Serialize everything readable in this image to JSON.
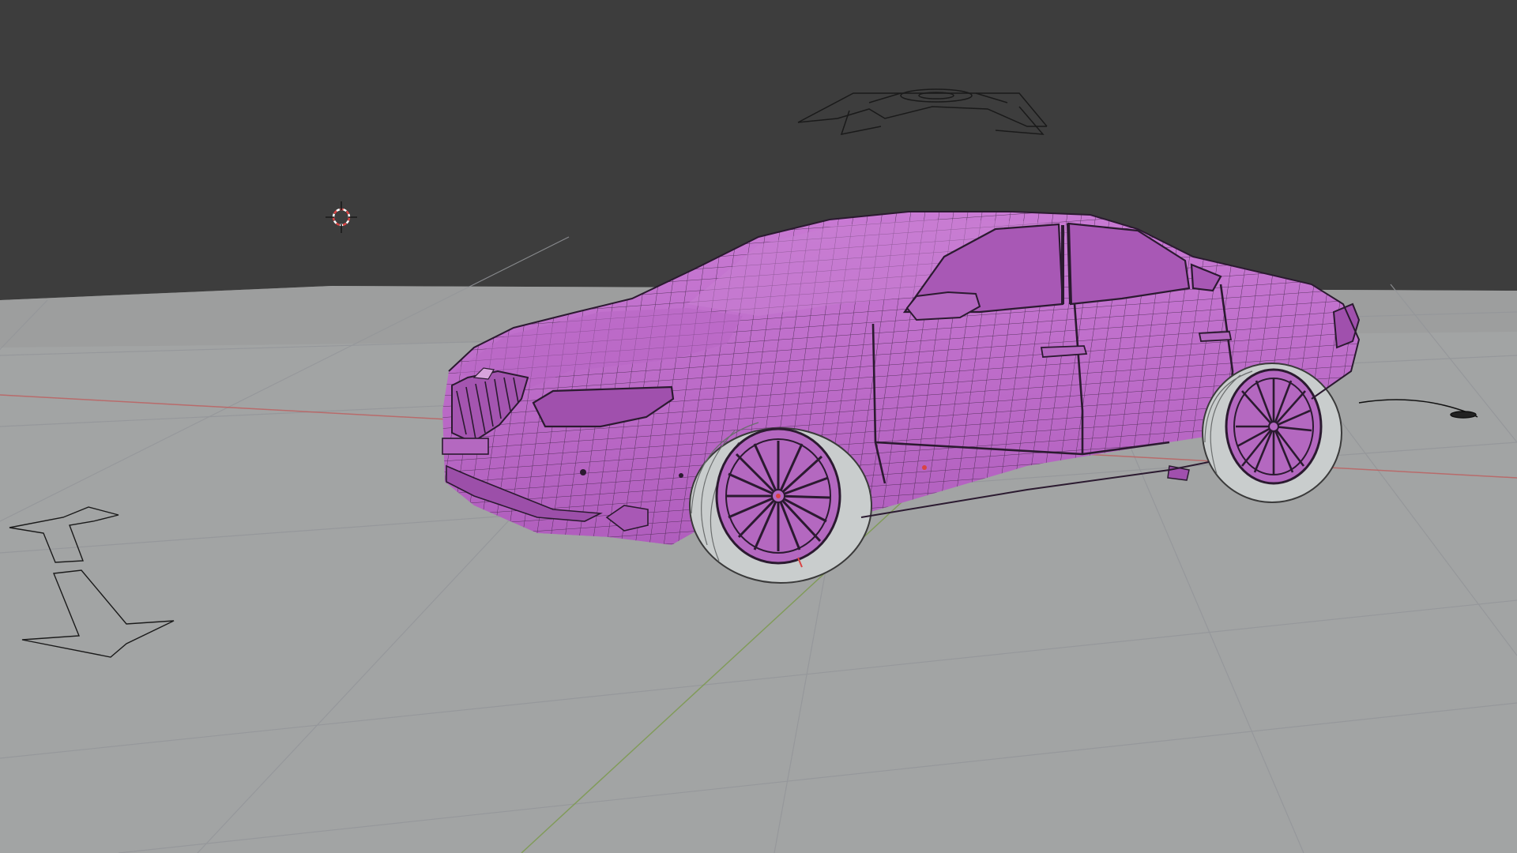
{
  "viewport": {
    "name": "3D Viewport",
    "background_color": "#3d3d3d",
    "floor_color": "#a2a4a4",
    "floor_shadow_color": "#8d8f8f",
    "grid_line_color": "#9a9c9c",
    "x_axis_color": "#c05858",
    "y_axis_color": "#7c9a4e"
  },
  "objects": {
    "car": {
      "mesh_color": "#c46fcf",
      "mesh_shade_color": "#9d50ab",
      "wire_color": "#2b1a30",
      "tire_color": "#cfd3d3"
    },
    "camera": {
      "icon": "camera-wire-icon"
    },
    "light": {
      "icon": "area-light-icon"
    },
    "cursor_3d": {
      "icon": "3d-cursor-icon",
      "ring_color": "#d94444"
    },
    "empty_arrows": {
      "icon": "double-arrow-empty-icon"
    }
  }
}
